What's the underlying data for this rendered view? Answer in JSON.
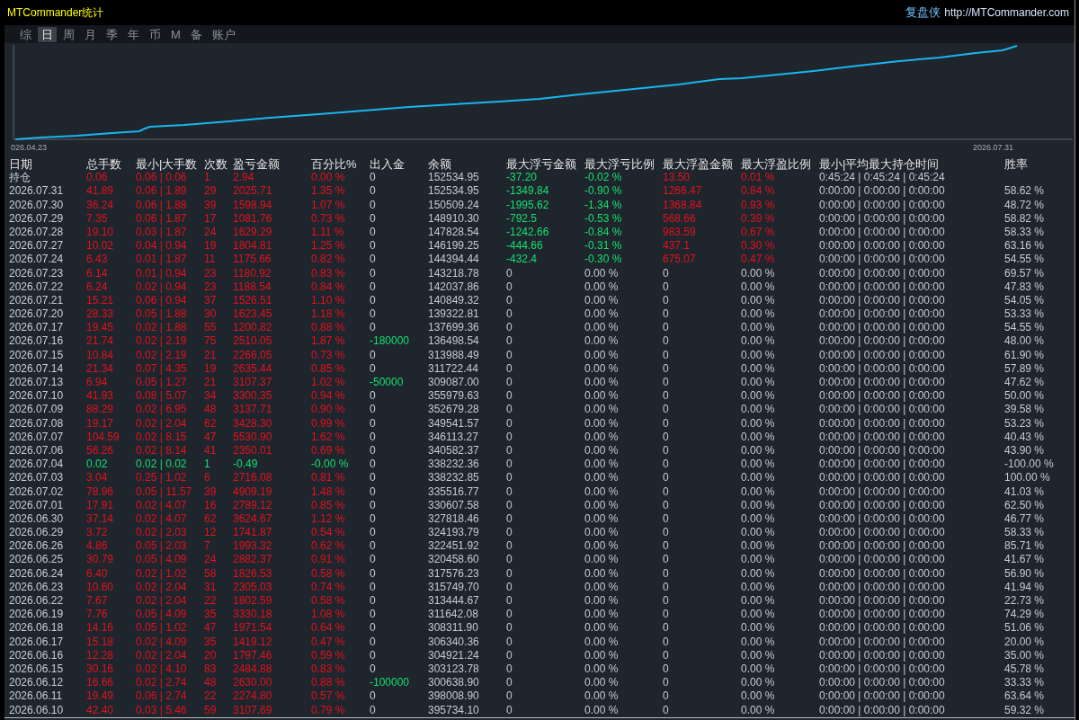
{
  "window": {
    "title": "MTCommander统计",
    "brand": "复盘侠",
    "website": "http://MTCommander.com"
  },
  "tabs": [
    {
      "label": "综",
      "selected": false
    },
    {
      "label": "日",
      "selected": true
    },
    {
      "label": "周",
      "selected": false
    },
    {
      "label": "月",
      "selected": false
    },
    {
      "label": "季",
      "selected": false
    },
    {
      "label": "年",
      "selected": false
    },
    {
      "label": "币",
      "selected": false
    },
    {
      "label": "M",
      "selected": false
    },
    {
      "label": "备",
      "selected": false
    },
    {
      "label": "账户",
      "selected": false
    }
  ],
  "chart": {
    "start_label": "026.04.23",
    "end_label": "2026.07.31"
  },
  "table": {
    "columns": [
      "日期",
      "总手数",
      "最小|大手数",
      "次数",
      "盈亏金额",
      "百分比%",
      "出入金",
      "余额",
      "最大浮亏金额",
      "最大浮亏比例",
      "最大浮盈金额",
      "最大浮盈比例",
      "最小|平均最大持仓时间",
      "胜率"
    ],
    "rows": [
      {
        "cells": [
          "持仓",
          "0.06",
          "0.06 | 0.06",
          "1",
          "2.94",
          "0.00 %",
          "0",
          "152534.95",
          "-37.20",
          "-0.02 %",
          "13.50",
          "0.01 %",
          "0:45:24 | 0:45:24 | 0:45:24"
        ],
        "loss": false,
        "deposit_highlighted": false,
        "float_loss_highlighted": true,
        "float_profit_highlighted": true
      },
      {
        "cells": [
          "2026.07.31",
          "41.89",
          "0.06 | 1.89",
          "29",
          "2025.71",
          "1.35 %",
          "0",
          "152534.95",
          "-1349.84",
          "-0.90 %",
          "1266.47",
          "0.84 %",
          "0:00:00 | 0:00:00 | 0:00:00",
          "58.62 %"
        ],
        "loss": false,
        "deposit_highlighted": false,
        "float_loss_highlighted": true,
        "float_profit_highlighted": true
      },
      {
        "cells": [
          "2026.07.30",
          "36.24",
          "0.06 | 1.88",
          "39",
          "1598.94",
          "1.07 %",
          "0",
          "150509.24",
          "-1995.62",
          "-1.34 %",
          "1368.84",
          "0.93 %",
          "0:00:00 | 0:00:00 | 0:00:00",
          "48.72 %"
        ],
        "loss": false,
        "deposit_highlighted": false,
        "float_loss_highlighted": true,
        "float_profit_highlighted": true
      },
      {
        "cells": [
          "2026.07.29",
          "7.35",
          "0.06 | 1.87",
          "17",
          "1081.76",
          "0.73 %",
          "0",
          "148910.30",
          "-792.5",
          "-0.53 %",
          "568.66",
          "0.39 %",
          "0:00:00 | 0:00:00 | 0:00:00",
          "58.82 %"
        ],
        "loss": false,
        "deposit_highlighted": false,
        "float_loss_highlighted": true,
        "float_profit_highlighted": true
      },
      {
        "cells": [
          "2026.07.28",
          "19.10",
          "0.03 | 1.87",
          "24",
          "1629.29",
          "1.11 %",
          "0",
          "147828.54",
          "-1242.66",
          "-0.84 %",
          "983.59",
          "0.67 %",
          "0:00:00 | 0:00:00 | 0:00:00",
          "58.33 %"
        ],
        "loss": false,
        "deposit_highlighted": false,
        "float_loss_highlighted": true,
        "float_profit_highlighted": true
      },
      {
        "cells": [
          "2026.07.27",
          "10.02",
          "0.04 | 0.94",
          "19",
          "1804.81",
          "1.25 %",
          "0",
          "146199.25",
          "-444.66",
          "-0.31 %",
          "437.1",
          "0.30 %",
          "0:00:00 | 0:00:00 | 0:00:00",
          "63.16 %"
        ],
        "loss": false,
        "deposit_highlighted": false,
        "float_loss_highlighted": true,
        "float_profit_highlighted": true
      },
      {
        "cells": [
          "2026.07.24",
          "6.43",
          "0.01 | 1.87",
          "11",
          "1175.66",
          "0.82 %",
          "0",
          "144394.44",
          "-432.4",
          "-0.30 %",
          "675.07",
          "0.47 %",
          "0:00:00 | 0:00:00 | 0:00:00",
          "54.55 %"
        ],
        "loss": false,
        "deposit_highlighted": false,
        "float_loss_highlighted": true,
        "float_profit_highlighted": true
      },
      {
        "cells": [
          "2026.07.23",
          "6.14",
          "0.01 | 0.94",
          "23",
          "1180.92",
          "0.83 %",
          "0",
          "143218.78",
          "0",
          "0.00 %",
          "0",
          "0.00 %",
          "0:00:00 | 0:00:00 | 0:00:00",
          "69.57 %"
        ],
        "loss": false,
        "deposit_highlighted": false,
        "float_loss_highlighted": false,
        "float_profit_highlighted": false
      },
      {
        "cells": [
          "2026.07.22",
          "6.24",
          "0.02 | 0.94",
          "23",
          "1188.54",
          "0.84 %",
          "0",
          "142037.86",
          "0",
          "0.00 %",
          "0",
          "0.00 %",
          "0:00:00 | 0:00:00 | 0:00:00",
          "47.83 %"
        ],
        "loss": false,
        "deposit_highlighted": false,
        "float_loss_highlighted": false,
        "float_profit_highlighted": false
      },
      {
        "cells": [
          "2026.07.21",
          "15.21",
          "0.06 | 0.94",
          "37",
          "1526.51",
          "1.10 %",
          "0",
          "140849.32",
          "0",
          "0.00 %",
          "0",
          "0.00 %",
          "0:00:00 | 0:00:00 | 0:00:00",
          "54.05 %"
        ],
        "loss": false,
        "deposit_highlighted": false,
        "float_loss_highlighted": false,
        "float_profit_highlighted": false
      },
      {
        "cells": [
          "2026.07.20",
          "28.33",
          "0.05 | 1.88",
          "30",
          "1623.45",
          "1.18 %",
          "0",
          "139322.81",
          "0",
          "0.00 %",
          "0",
          "0.00 %",
          "0:00:00 | 0:00:00 | 0:00:00",
          "53.33 %"
        ],
        "loss": false,
        "deposit_highlighted": false,
        "float_loss_highlighted": false,
        "float_profit_highlighted": false
      },
      {
        "cells": [
          "2026.07.17",
          "19.45",
          "0.02 | 1.88",
          "55",
          "1200.82",
          "0.88 %",
          "0",
          "137699.36",
          "0",
          "0.00 %",
          "0",
          "0.00 %",
          "0:00:00 | 0:00:00 | 0:00:00",
          "54.55 %"
        ],
        "loss": false,
        "deposit_highlighted": false,
        "float_loss_highlighted": false,
        "float_profit_highlighted": false
      },
      {
        "cells": [
          "2026.07.16",
          "21.74",
          "0.02 | 2.19",
          "75",
          "2510.05",
          "1.87 %",
          "-180000",
          "136498.54",
          "0",
          "0.00 %",
          "0",
          "0.00 %",
          "0:00:00 | 0:00:00 | 0:00:00",
          "48.00 %"
        ],
        "loss": false,
        "deposit_highlighted": true,
        "float_loss_highlighted": false,
        "float_profit_highlighted": false
      },
      {
        "cells": [
          "2026.07.15",
          "10.84",
          "0.02 | 2.19",
          "21",
          "2266.05",
          "0.73 %",
          "0",
          "313988.49",
          "0",
          "0.00 %",
          "0",
          "0.00 %",
          "0:00:00 | 0:00:00 | 0:00:00",
          "61.90 %"
        ],
        "loss": false,
        "deposit_highlighted": false,
        "float_loss_highlighted": false,
        "float_profit_highlighted": false
      },
      {
        "cells": [
          "2026.07.14",
          "21.34",
          "0.07 | 4.35",
          "19",
          "2635.44",
          "0.85 %",
          "0",
          "311722.44",
          "0",
          "0.00 %",
          "0",
          "0.00 %",
          "0:00:00 | 0:00:00 | 0:00:00",
          "57.89 %"
        ],
        "loss": false,
        "deposit_highlighted": false,
        "float_loss_highlighted": false,
        "float_profit_highlighted": false
      },
      {
        "cells": [
          "2026.07.13",
          "6.94",
          "0.05 | 1.27",
          "21",
          "3107.37",
          "1.02 %",
          "-50000",
          "309087.00",
          "0",
          "0.00 %",
          "0",
          "0.00 %",
          "0:00:00 | 0:00:00 | 0:00:00",
          "47.62 %"
        ],
        "loss": false,
        "deposit_highlighted": true,
        "float_loss_highlighted": false,
        "float_profit_highlighted": false
      },
      {
        "cells": [
          "2026.07.10",
          "41.93",
          "0.08 | 5.07",
          "34",
          "3300.35",
          "0.94 %",
          "0",
          "355979.63",
          "0",
          "0.00 %",
          "0",
          "0.00 %",
          "0:00:00 | 0:00:00 | 0:00:00",
          "50.00 %"
        ],
        "loss": false,
        "deposit_highlighted": false,
        "float_loss_highlighted": false,
        "float_profit_highlighted": false
      },
      {
        "cells": [
          "2026.07.09",
          "88.29",
          "0.02 | 6.95",
          "48",
          "3137.71",
          "0.90 %",
          "0",
          "352679.28",
          "0",
          "0.00 %",
          "0",
          "0.00 %",
          "0:00:00 | 0:00:00 | 0:00:00",
          "39.58 %"
        ],
        "loss": false,
        "deposit_highlighted": false,
        "float_loss_highlighted": false,
        "float_profit_highlighted": false
      },
      {
        "cells": [
          "2026.07.08",
          "19.17",
          "0.02 | 2.04",
          "62",
          "3428.30",
          "0.99 %",
          "0",
          "349541.57",
          "0",
          "0.00 %",
          "0",
          "0.00 %",
          "0:00:00 | 0:00:00 | 0:00:00",
          "53.23 %"
        ],
        "loss": false,
        "deposit_highlighted": false,
        "float_loss_highlighted": false,
        "float_profit_highlighted": false
      },
      {
        "cells": [
          "2026.07.07",
          "104.59",
          "0.02 | 8.15",
          "47",
          "5530.90",
          "1.62 %",
          "0",
          "346113.27",
          "0",
          "0.00 %",
          "0",
          "0.00 %",
          "0:00:00 | 0:00:00 | 0:00:00",
          "40.43 %"
        ],
        "loss": false,
        "deposit_highlighted": false,
        "float_loss_highlighted": false,
        "float_profit_highlighted": false
      },
      {
        "cells": [
          "2026.07.06",
          "56.26",
          "0.02 | 8.14",
          "41",
          "2350.01",
          "0.69 %",
          "0",
          "340582.37",
          "0",
          "0.00 %",
          "0",
          "0.00 %",
          "0:00:00 | 0:00:00 | 0:00:00",
          "43.90 %"
        ],
        "loss": false,
        "deposit_highlighted": false,
        "float_loss_highlighted": false,
        "float_profit_highlighted": false
      },
      {
        "cells": [
          "2026.07.04",
          "0.02",
          "0.02 | 0.02",
          "1",
          "-0.49",
          "-0.00 %",
          "0",
          "338232.36",
          "0",
          "0.00 %",
          "0",
          "0.00 %",
          "0:00:00 | 0:00:00 | 0:00:00",
          "-100.00 %"
        ],
        "loss": true,
        "deposit_highlighted": false,
        "float_loss_highlighted": false,
        "float_profit_highlighted": false
      },
      {
        "cells": [
          "2026.07.03",
          "3.04",
          "0.25 | 1.02",
          "6",
          "2716.08",
          "0.81 %",
          "0",
          "338232.85",
          "0",
          "0.00 %",
          "0",
          "0.00 %",
          "0:00:00 | 0:00:00 | 0:00:00",
          "100.00 %"
        ],
        "loss": false,
        "deposit_highlighted": false,
        "float_loss_highlighted": false,
        "float_profit_highlighted": false
      },
      {
        "cells": [
          "2026.07.02",
          "78.96",
          "0.05 | 11.57",
          "39",
          "4909.19",
          "1.48 %",
          "0",
          "335516.77",
          "0",
          "0.00 %",
          "0",
          "0.00 %",
          "0:00:00 | 0:00:00 | 0:00:00",
          "41.03 %"
        ],
        "loss": false,
        "deposit_highlighted": false,
        "float_loss_highlighted": false,
        "float_profit_highlighted": false
      },
      {
        "cells": [
          "2026.07.01",
          "17.91",
          "0.02 | 4.07",
          "16",
          "2789.12",
          "0.85 %",
          "0",
          "330607.58",
          "0",
          "0.00 %",
          "0",
          "0.00 %",
          "0:00:00 | 0:00:00 | 0:00:00",
          "62.50 %"
        ],
        "loss": false,
        "deposit_highlighted": false,
        "float_loss_highlighted": false,
        "float_profit_highlighted": false
      },
      {
        "cells": [
          "2026.06.30",
          "37.14",
          "0.02 | 4.07",
          "62",
          "3624.67",
          "1.12 %",
          "0",
          "327818.46",
          "0",
          "0.00 %",
          "0",
          "0.00 %",
          "0:00:00 | 0:00:00 | 0:00:00",
          "46.77 %"
        ],
        "loss": false,
        "deposit_highlighted": false,
        "float_loss_highlighted": false,
        "float_profit_highlighted": false
      },
      {
        "cells": [
          "2026.06.29",
          "3.72",
          "0.02 | 2.03",
          "12",
          "1741.87",
          "0.54 %",
          "0",
          "324193.79",
          "0",
          "0.00 %",
          "0",
          "0.00 %",
          "0:00:00 | 0:00:00 | 0:00:00",
          "58.33 %"
        ],
        "loss": false,
        "deposit_highlighted": false,
        "float_loss_highlighted": false,
        "float_profit_highlighted": false
      },
      {
        "cells": [
          "2026.06.26",
          "4.86",
          "0.05 | 2.03",
          "7",
          "1993.32",
          "0.62 %",
          "0",
          "322451.92",
          "0",
          "0.00 %",
          "0",
          "0.00 %",
          "0:00:00 | 0:00:00 | 0:00:00",
          "85.71 %"
        ],
        "loss": false,
        "deposit_highlighted": false,
        "float_loss_highlighted": false,
        "float_profit_highlighted": false
      },
      {
        "cells": [
          "2026.06.25",
          "30.79",
          "0.05 | 4.09",
          "24",
          "2882.37",
          "0.91 %",
          "0",
          "320458.60",
          "0",
          "0.00 %",
          "0",
          "0.00 %",
          "0:00:00 | 0:00:00 | 0:00:00",
          "41.67 %"
        ],
        "loss": false,
        "deposit_highlighted": false,
        "float_loss_highlighted": false,
        "float_profit_highlighted": false
      },
      {
        "cells": [
          "2026.06.24",
          "6.40",
          "0.02 | 1.02",
          "58",
          "1826.53",
          "0.58 %",
          "0",
          "317576.23",
          "0",
          "0.00 %",
          "0",
          "0.00 %",
          "0:00:00 | 0:00:00 | 0:00:00",
          "56.90 %"
        ],
        "loss": false,
        "deposit_highlighted": false,
        "float_loss_highlighted": false,
        "float_profit_highlighted": false
      },
      {
        "cells": [
          "2026.06.23",
          "10.60",
          "0.02 | 2.04",
          "31",
          "2305.03",
          "0.74 %",
          "0",
          "315749.70",
          "0",
          "0.00 %",
          "0",
          "0.00 %",
          "0:00:00 | 0:00:00 | 0:00:00",
          "41.94 %"
        ],
        "loss": false,
        "deposit_highlighted": false,
        "float_loss_highlighted": false,
        "float_profit_highlighted": false
      },
      {
        "cells": [
          "2026.06.22",
          "7.67",
          "0.02 | 2.04",
          "22",
          "1802.59",
          "0.58 %",
          "0",
          "313444.67",
          "0",
          "0.00 %",
          "0",
          "0.00 %",
          "0:00:00 | 0:00:00 | 0:00:00",
          "22.73 %"
        ],
        "loss": false,
        "deposit_highlighted": false,
        "float_loss_highlighted": false,
        "float_profit_highlighted": false
      },
      {
        "cells": [
          "2026.06.19",
          "7.76",
          "0.05 | 4.09",
          "35",
          "3330.18",
          "1.08 %",
          "0",
          "311642.08",
          "0",
          "0.00 %",
          "0",
          "0.00 %",
          "0:00:00 | 0:00:00 | 0:00:00",
          "74.29 %"
        ],
        "loss": false,
        "deposit_highlighted": false,
        "float_loss_highlighted": false,
        "float_profit_highlighted": false
      },
      {
        "cells": [
          "2026.06.18",
          "14.16",
          "0.05 | 1.02",
          "47",
          "1971.54",
          "0.64 %",
          "0",
          "308311.90",
          "0",
          "0.00 %",
          "0",
          "0.00 %",
          "0:00:00 | 0:00:00 | 0:00:00",
          "51.06 %"
        ],
        "loss": false,
        "deposit_highlighted": false,
        "float_loss_highlighted": false,
        "float_profit_highlighted": false
      },
      {
        "cells": [
          "2026.06.17",
          "15.18",
          "0.02 | 4.09",
          "35",
          "1419.12",
          "0.47 %",
          "0",
          "306340.36",
          "0",
          "0.00 %",
          "0",
          "0.00 %",
          "0:00:00 | 0:00:00 | 0:00:00",
          "20.00 %"
        ],
        "loss": false,
        "deposit_highlighted": false,
        "float_loss_highlighted": false,
        "float_profit_highlighted": false
      },
      {
        "cells": [
          "2026.06.16",
          "12.28",
          "0.02 | 2.04",
          "20",
          "1797.46",
          "0.59 %",
          "0",
          "304921.24",
          "0",
          "0.00 %",
          "0",
          "0.00 %",
          "0:00:00 | 0:00:00 | 0:00:00",
          "35.00 %"
        ],
        "loss": false,
        "deposit_highlighted": false,
        "float_loss_highlighted": false,
        "float_profit_highlighted": false
      },
      {
        "cells": [
          "2026.06.15",
          "30.16",
          "0.02 | 4.10",
          "83",
          "2484.88",
          "0.83 %",
          "0",
          "303123.78",
          "0",
          "0.00 %",
          "0",
          "0.00 %",
          "0:00:00 | 0:00:00 | 0:00:00",
          "45.78 %"
        ],
        "loss": false,
        "deposit_highlighted": false,
        "float_loss_highlighted": false,
        "float_profit_highlighted": false
      },
      {
        "cells": [
          "2026.06.12",
          "16.66",
          "0.02 | 2.74",
          "48",
          "2630.00",
          "0.88 %",
          "-100000",
          "300638.90",
          "0",
          "0.00 %",
          "0",
          "0.00 %",
          "0:00:00 | 0:00:00 | 0:00:00",
          "33.33 %"
        ],
        "loss": false,
        "deposit_highlighted": true,
        "float_loss_highlighted": false,
        "float_profit_highlighted": false
      },
      {
        "cells": [
          "2026.06.11",
          "19.49",
          "0.06 | 2.74",
          "22",
          "2274.80",
          "0.57 %",
          "0",
          "398008.90",
          "0",
          "0.00 %",
          "0",
          "0.00 %",
          "0:00:00 | 0:00:00 | 0:00:00",
          "63.64 %"
        ],
        "loss": false,
        "deposit_highlighted": false,
        "float_loss_highlighted": false,
        "float_profit_highlighted": false
      },
      {
        "cells": [
          "2026.06.10",
          "42.40",
          "0.03 | 5.46",
          "59",
          "3107.69",
          "0.79 %",
          "0",
          "395734.10",
          "0",
          "0.00 %",
          "0",
          "0.00 %",
          "0:00:00 | 0:00:00 | 0:00:00",
          "59.32 %"
        ],
        "loss": false,
        "deposit_highlighted": false,
        "float_loss_highlighted": false,
        "float_profit_highlighted": false
      }
    ]
  }
}
